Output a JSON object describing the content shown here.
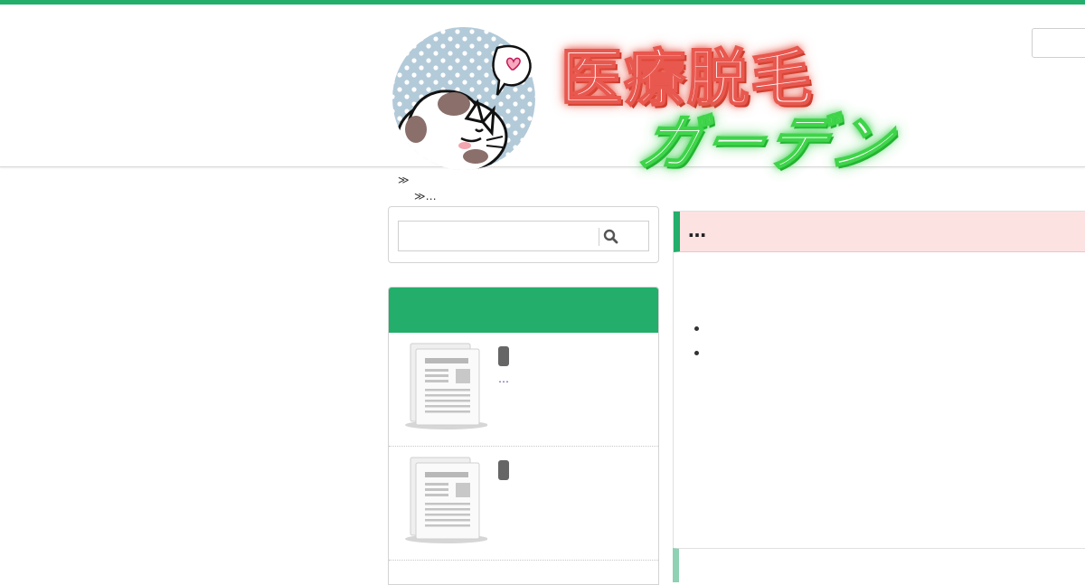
{
  "site": {
    "logo_title": "医療脱毛",
    "logo_subtitle": "ガーデン",
    "brand_color": "#23ae6b",
    "accent_color": "#fde2e2"
  },
  "breadcrumb": {
    "separator1": "≫",
    "separator2": "≫…"
  },
  "search": {
    "placeholder": "",
    "icon": "search-icon"
  },
  "sidebar": {
    "header_label": "",
    "posts": [
      {
        "thumbnail_icon": "document-thumbnail-icon",
        "snippet": "…"
      },
      {
        "thumbnail_icon": "document-thumbnail-icon",
        "snippet": ""
      }
    ]
  },
  "main": {
    "title": "…",
    "list_items": [
      "",
      ""
    ]
  }
}
